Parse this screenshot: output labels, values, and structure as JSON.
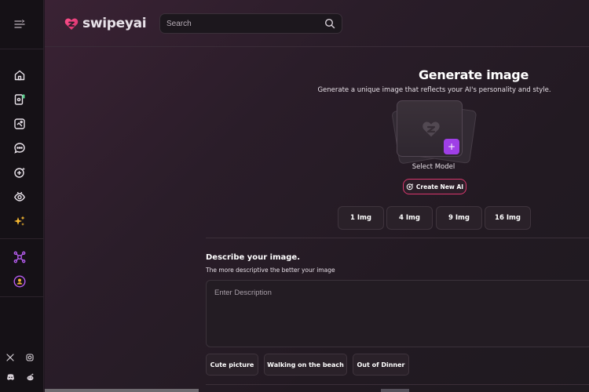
{
  "app": {
    "brand": "swipeyai",
    "colors": {
      "accent": "#9f3fe6",
      "pink": "#d9376d",
      "background": "#201720"
    }
  },
  "sidebar": {
    "toggle_icon": "sidebar-toggle-icon",
    "items": [
      {
        "name": "home",
        "icon": "home-icon"
      },
      {
        "name": "swipe-cards",
        "icon": "cards-icon"
      },
      {
        "name": "gallery",
        "icon": "gallery-icon"
      },
      {
        "name": "chat",
        "icon": "chat-icon"
      },
      {
        "name": "create-ai",
        "icon": "add-sparkle-icon"
      },
      {
        "name": "explore",
        "icon": "eye-icon"
      },
      {
        "name": "generate-image",
        "icon": "sparkles-icon"
      },
      {
        "name": "affiliate",
        "icon": "network-icon"
      },
      {
        "name": "profile",
        "icon": "user-badge-icon"
      }
    ],
    "social": [
      "x-icon",
      "instagram-icon",
      "discord-icon",
      "reddit-icon"
    ]
  },
  "header": {
    "search_placeholder": "Search"
  },
  "generate": {
    "title": "Generate image",
    "subtitle": "Generate a unique image that reflects your AI's personality and style.",
    "select_model_label": "Select Model",
    "add_button": "+",
    "create_button": "Create New AI",
    "counts": [
      "1 Img",
      "4 Img",
      "9 Img",
      "16 Img"
    ]
  },
  "describe": {
    "title": "Describe your image.",
    "subtitle": "The more descriptive the better your image",
    "placeholder": "Enter Description",
    "suggestions": [
      "Cute picture",
      "Walking on the beach",
      "Out of Dinner"
    ]
  }
}
